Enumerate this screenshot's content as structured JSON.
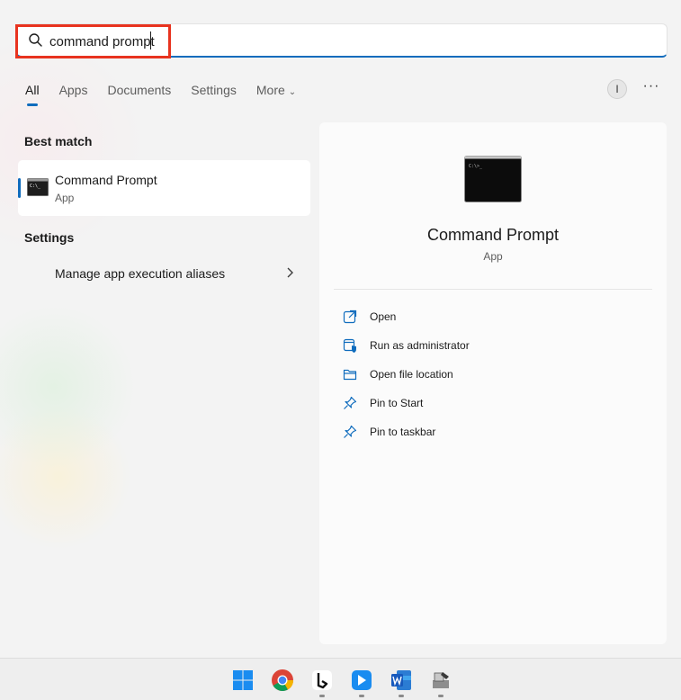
{
  "search": {
    "query": "command prompt",
    "icon": "search-icon"
  },
  "tabs": [
    {
      "label": "All",
      "active": true
    },
    {
      "label": "Apps"
    },
    {
      "label": "Documents"
    },
    {
      "label": "Settings"
    },
    {
      "label": "More"
    }
  ],
  "header": {
    "avatar_initial": "I",
    "more_label": "···"
  },
  "best_match": {
    "section_title": "Best match",
    "name": "Command Prompt",
    "type": "App"
  },
  "settings_section": {
    "section_title": "Settings",
    "item_label": "Manage app execution aliases"
  },
  "detail": {
    "name": "Command Prompt",
    "type": "App",
    "actions": [
      {
        "label": "Open",
        "icon": "open-icon"
      },
      {
        "label": "Run as administrator",
        "icon": "shield-icon"
      },
      {
        "label": "Open file location",
        "icon": "folder-icon"
      },
      {
        "label": "Pin to Start",
        "icon": "pin-icon"
      },
      {
        "label": "Pin to taskbar",
        "icon": "pin-icon"
      }
    ]
  },
  "taskbar": {
    "apps": [
      "start-icon",
      "chrome-icon",
      "bing-icon",
      "pin-app-icon",
      "word-icon",
      "installer-icon"
    ]
  },
  "colors": {
    "accent": "#0f6cbd",
    "highlight": "#e8331f"
  }
}
